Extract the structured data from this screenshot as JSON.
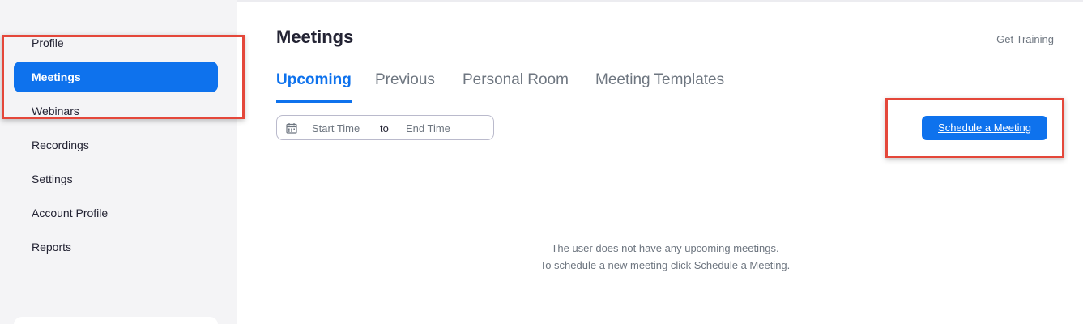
{
  "sidebar": {
    "items": [
      {
        "label": "Profile"
      },
      {
        "label": "Meetings"
      },
      {
        "label": "Webinars"
      },
      {
        "label": "Recordings"
      },
      {
        "label": "Settings"
      },
      {
        "label": "Account Profile"
      },
      {
        "label": "Reports"
      }
    ]
  },
  "header": {
    "title": "Meetings",
    "get_training": "Get Training"
  },
  "tabs": [
    {
      "label": "Upcoming"
    },
    {
      "label": "Previous"
    },
    {
      "label": "Personal Room"
    },
    {
      "label": "Meeting Templates"
    }
  ],
  "date_range": {
    "start": "Start Time",
    "to": "to",
    "end": "End Time"
  },
  "schedule_button": "Schedule a Meeting",
  "empty_state": {
    "line1": "The user does not have any upcoming meetings.",
    "line2": "To schedule a new meeting click Schedule a Meeting."
  },
  "colors": {
    "accent": "#0e72ed",
    "highlight": "#e4473a"
  }
}
